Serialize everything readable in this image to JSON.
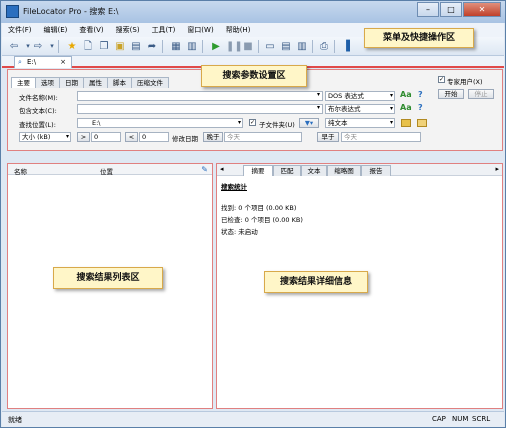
{
  "window": {
    "title": "FileLocator Pro - 搜索 E:\\"
  },
  "window_buttons": {
    "minimize": "–",
    "maximize": "□",
    "close": "✕"
  },
  "menu": [
    "文件(F)",
    "编辑(E)",
    "查看(V)",
    "搜索(S)",
    "工具(T)",
    "窗口(W)",
    "帮助(H)"
  ],
  "toolbar_icons": [
    "back-icon",
    "dropdown-icon",
    "forward-icon",
    "dropdown-icon",
    "star-icon",
    "new-document-icon",
    "copy-icon",
    "lock-icon",
    "save-icon",
    "export-icon",
    "properties-icon",
    "print-preview-icon",
    "play-icon",
    "pause-icon",
    "stop-icon",
    "layout-icon",
    "panel-icon",
    "columns-icon",
    "printer-icon",
    "book-icon"
  ],
  "doc_tab": {
    "label": "E:\\",
    "close": "×"
  },
  "param_tabs": [
    "主要",
    "选项",
    "日期",
    "属性",
    "脚本",
    "压缩文件"
  ],
  "params": {
    "filename_label": "文件名称(M):",
    "filename_value": "",
    "filename_mode": "DOS 表达式",
    "content_label": "包含文本(C):",
    "content_value": "",
    "content_mode": "布尔表达式",
    "lookin_label": "查找位置(L):",
    "lookin_value": "E:\\",
    "subfolder_label": "子文件夹(U)",
    "subfolder_checked": true,
    "text_type": "纯文本",
    "size_label": "大小 (kB)",
    "size_gt": ">",
    "size_min": "0",
    "size_lt": "<",
    "size_max": "0",
    "modified_label": "修改日期",
    "after_label": "晚于",
    "after_value": "今天",
    "before_label": "早于",
    "before_value": "今天",
    "expert_label": "专家用户(X)",
    "expert_checked": true,
    "start_label": "开始",
    "stop_label": "停止",
    "aa_label": "Aa",
    "help_label": "?"
  },
  "results_list": {
    "col_name": "名称",
    "col_location": "位置"
  },
  "details": {
    "tabs": [
      "摘要",
      "匹配",
      "文本",
      "缩略图",
      "报告"
    ],
    "heading": "搜索统计",
    "found": "找到: 0 个项目 (0.00 KB)",
    "checked": "已检查: 0 个项目 (0.00 KB)",
    "status": "状态: 未启动"
  },
  "callouts": {
    "menu": "菜单及快捷操作区",
    "params": "搜索参数设置区",
    "results": "搜索结果列表区",
    "details": "搜索结果详细信息"
  },
  "statusbar": {
    "ready": "就绪",
    "cap": "CAP",
    "num": "NUM",
    "scrl": "SCRL"
  }
}
